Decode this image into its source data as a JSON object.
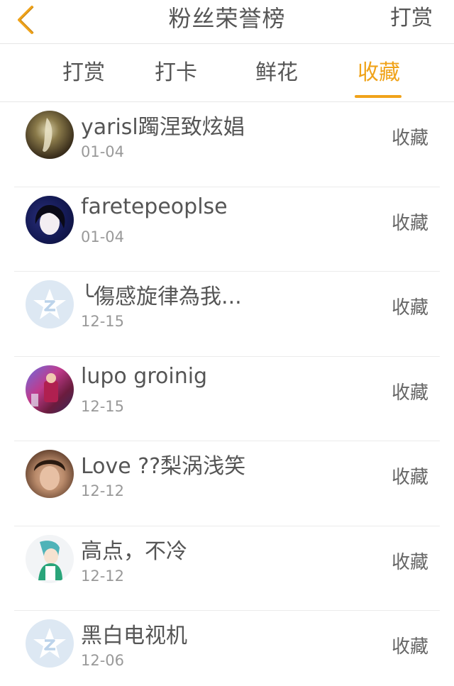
{
  "header": {
    "title": "粉丝荣誉榜",
    "right_action": "打赏"
  },
  "tabs": [
    {
      "label": "打赏"
    },
    {
      "label": "打卡"
    },
    {
      "label": "鲜花"
    },
    {
      "label": "收藏"
    }
  ],
  "active_tab": "收藏",
  "accent_color": "#f0a31a",
  "rows": [
    {
      "name": "yarisl躅涅致炫娼",
      "date": "01-04",
      "action": "收藏",
      "avatar": "photo-avatar"
    },
    {
      "name": "faretepeoplse",
      "date": "01-04",
      "action": "收藏",
      "avatar": "photo-avatar"
    },
    {
      "name": "╰傷感旋律為我...",
      "date": "12-15",
      "action": "收藏",
      "avatar": "default-qq-avatar"
    },
    {
      "name": "lupo groinig",
      "date": "12-15",
      "action": "收藏",
      "avatar": "photo-avatar"
    },
    {
      "name": "Love ??梨涡浅笑",
      "date": "12-12",
      "action": "收藏",
      "avatar": "photo-avatar"
    },
    {
      "name": "高点，不冷",
      "date": "12-12",
      "action": "收藏",
      "avatar": "photo-avatar"
    },
    {
      "name": "黑白电视机",
      "date": "12-06",
      "action": "收藏",
      "avatar": "default-qq-avatar"
    }
  ]
}
